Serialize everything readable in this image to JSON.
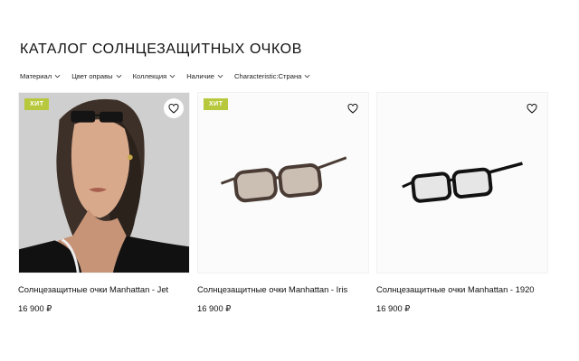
{
  "catalog": {
    "title": "КАТАЛОГ СОЛНЦЕЗАЩИТНЫХ ОЧКОВ",
    "filters": [
      {
        "label": "Материал",
        "icon": "chevron-down-icon"
      },
      {
        "label": "Цвет оправы",
        "icon": "chevron-down-icon"
      },
      {
        "label": "Коллекция",
        "icon": "chevron-down-icon"
      },
      {
        "label": "Наличие",
        "icon": "chevron-down-icon"
      },
      {
        "label": "Characteristic:Страна",
        "icon": "chevron-down-icon"
      }
    ],
    "products": [
      {
        "badge": "ХИТ",
        "name": "Солнцезащитные очки Manhattan - Jet",
        "price": "16 900 ₽",
        "favorite_icon": "heart-icon"
      },
      {
        "badge": "ХИТ",
        "name": "Солнцезащитные очки Manhattan - Iris",
        "price": "16 900 ₽",
        "favorite_icon": "heart-icon"
      },
      {
        "badge": "",
        "name": "Солнцезащитные очки Manhattan - 1920",
        "price": "16 900 ₽",
        "favorite_icon": "heart-icon"
      }
    ]
  },
  "colors": {
    "badge": "#b8c83c",
    "text": "#111111",
    "background": "#ffffff"
  }
}
